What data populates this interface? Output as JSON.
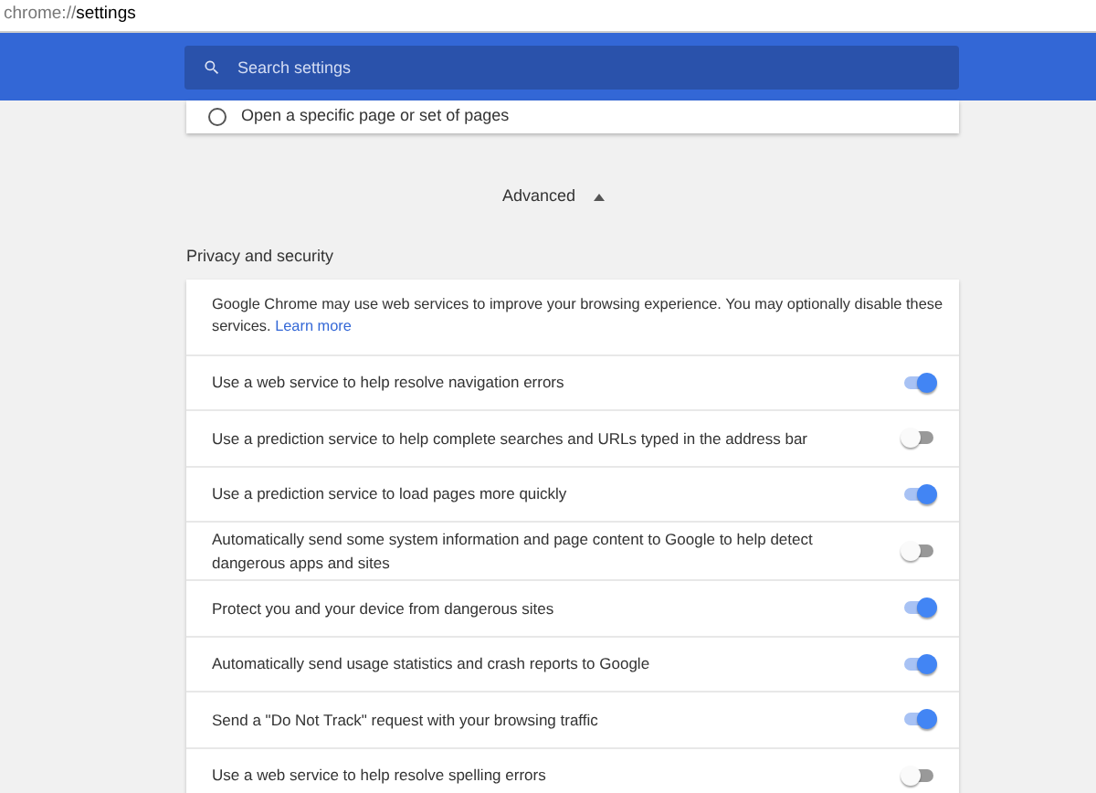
{
  "address_bar": {
    "scheme": "chrome://",
    "path": "settings"
  },
  "search": {
    "placeholder": "Search settings"
  },
  "startup_card": {
    "option": {
      "label": "Open a specific page or set of pages",
      "selected": false
    }
  },
  "advanced": {
    "label": "Advanced",
    "expanded": true
  },
  "section": {
    "title": "Privacy and security"
  },
  "intro": {
    "text": "Google Chrome may use web services to improve your browsing experience. You may optionally disable these services.",
    "link": "Learn more"
  },
  "settings": [
    {
      "label": "Use a web service to help resolve navigation errors",
      "on": true
    },
    {
      "label": "Use a prediction service to help complete searches and URLs typed in the address bar",
      "on": false
    },
    {
      "label": "Use a prediction service to load pages more quickly",
      "on": true
    },
    {
      "label": "Automatically send some system information and page content to Google to help detect dangerous apps and sites",
      "on": false
    },
    {
      "label": "Protect you and your device from dangerous sites",
      "on": true
    },
    {
      "label": "Automatically send usage statistics and crash reports to Google",
      "on": true
    },
    {
      "label": "Send a \"Do Not Track\" request with your browsing traffic",
      "on": true
    },
    {
      "label": "Use a web service to help resolve spelling errors",
      "on": false
    }
  ]
}
